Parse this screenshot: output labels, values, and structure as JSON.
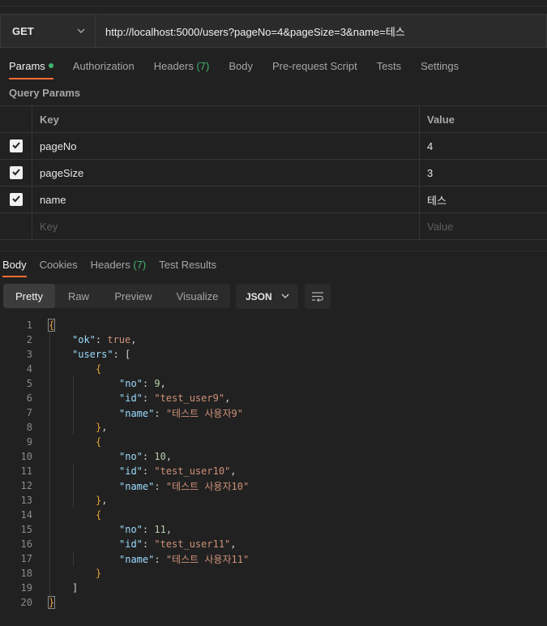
{
  "request": {
    "method": "GET",
    "url": "http://localhost:5000/users?pageNo=4&pageSize=3&name=테스"
  },
  "request_tabs": [
    {
      "label": "Params",
      "count": "",
      "dot": true,
      "active": true
    },
    {
      "label": "Authorization",
      "count": "",
      "dot": false,
      "active": false
    },
    {
      "label": "Headers",
      "count": "(7)",
      "dot": false,
      "active": false
    },
    {
      "label": "Body",
      "count": "",
      "dot": false,
      "active": false
    },
    {
      "label": "Pre-request Script",
      "count": "",
      "dot": false,
      "active": false
    },
    {
      "label": "Tests",
      "count": "",
      "dot": false,
      "active": false
    },
    {
      "label": "Settings",
      "count": "",
      "dot": false,
      "active": false
    }
  ],
  "query_params": {
    "title": "Query Params",
    "headers": {
      "key": "Key",
      "value": "Value"
    },
    "rows": [
      {
        "key": "pageNo",
        "value": "4",
        "checked": true
      },
      {
        "key": "pageSize",
        "value": "3",
        "checked": true
      },
      {
        "key": "name",
        "value": "테스",
        "checked": true
      }
    ],
    "placeholder": {
      "key": "Key",
      "value": "Value"
    }
  },
  "response_tabs": [
    {
      "label": "Body",
      "count": "",
      "active": true
    },
    {
      "label": "Cookies",
      "count": "",
      "active": false
    },
    {
      "label": "Headers",
      "count": "(7)",
      "active": false
    },
    {
      "label": "Test Results",
      "count": "",
      "active": false
    }
  ],
  "format": {
    "buttons": [
      "Pretty",
      "Raw",
      "Preview",
      "Visualize"
    ],
    "active": "Pretty",
    "language": "JSON"
  },
  "code_lines": [
    {
      "n": "1",
      "i": 0,
      "t": [
        [
          "b",
          "{"
        ]
      ]
    },
    {
      "n": "2",
      "i": 1,
      "t": [
        [
          "k",
          "\"ok\""
        ],
        [
          "p",
          ": "
        ],
        [
          "s",
          "true"
        ],
        [
          "p",
          ","
        ]
      ]
    },
    {
      "n": "3",
      "i": 1,
      "t": [
        [
          "k",
          "\"users\""
        ],
        [
          "p",
          ": ["
        ]
      ]
    },
    {
      "n": "4",
      "i": 2,
      "t": [
        [
          "b",
          "{"
        ]
      ]
    },
    {
      "n": "5",
      "i": 3,
      "t": [
        [
          "k",
          "\"no\""
        ],
        [
          "p",
          ": "
        ],
        [
          "n",
          "9"
        ],
        [
          "p",
          ","
        ]
      ]
    },
    {
      "n": "6",
      "i": 3,
      "t": [
        [
          "k",
          "\"id\""
        ],
        [
          "p",
          ": "
        ],
        [
          "s",
          "\"test_user9\""
        ],
        [
          "p",
          ","
        ]
      ]
    },
    {
      "n": "7",
      "i": 3,
      "t": [
        [
          "k",
          "\"name\""
        ],
        [
          "p",
          ": "
        ],
        [
          "s",
          "\"테스트 사용자9\""
        ]
      ]
    },
    {
      "n": "8",
      "i": 2,
      "t": [
        [
          "b",
          "}"
        ],
        [
          "p",
          ","
        ]
      ]
    },
    {
      "n": "9",
      "i": 2,
      "t": [
        [
          "b",
          "{"
        ]
      ]
    },
    {
      "n": "10",
      "i": 3,
      "t": [
        [
          "k",
          "\"no\""
        ],
        [
          "p",
          ": "
        ],
        [
          "n",
          "10"
        ],
        [
          "p",
          ","
        ]
      ]
    },
    {
      "n": "11",
      "i": 3,
      "t": [
        [
          "k",
          "\"id\""
        ],
        [
          "p",
          ": "
        ],
        [
          "s",
          "\"test_user10\""
        ],
        [
          "p",
          ","
        ]
      ]
    },
    {
      "n": "12",
      "i": 3,
      "t": [
        [
          "k",
          "\"name\""
        ],
        [
          "p",
          ": "
        ],
        [
          "s",
          "\"테스트 사용자10\""
        ]
      ]
    },
    {
      "n": "13",
      "i": 2,
      "t": [
        [
          "b",
          "}"
        ],
        [
          "p",
          ","
        ]
      ]
    },
    {
      "n": "14",
      "i": 2,
      "t": [
        [
          "b",
          "{"
        ]
      ]
    },
    {
      "n": "15",
      "i": 3,
      "t": [
        [
          "k",
          "\"no\""
        ],
        [
          "p",
          ": "
        ],
        [
          "n",
          "11"
        ],
        [
          "p",
          ","
        ]
      ]
    },
    {
      "n": "16",
      "i": 3,
      "t": [
        [
          "k",
          "\"id\""
        ],
        [
          "p",
          ": "
        ],
        [
          "s",
          "\"test_user11\""
        ],
        [
          "p",
          ","
        ]
      ]
    },
    {
      "n": "17",
      "i": 3,
      "t": [
        [
          "k",
          "\"name\""
        ],
        [
          "p",
          ": "
        ],
        [
          "s",
          "\"테스트 사용자11\""
        ]
      ]
    },
    {
      "n": "18",
      "i": 2,
      "t": [
        [
          "b",
          "}"
        ]
      ]
    },
    {
      "n": "19",
      "i": 1,
      "t": [
        [
          "p",
          "]"
        ]
      ]
    },
    {
      "n": "20",
      "i": 0,
      "t": [
        [
          "b",
          "}"
        ]
      ]
    }
  ],
  "icons": {
    "method_dropdown": "chevron-down-icon",
    "checkbox": "check-icon",
    "format_dropdown": "chevron-down-icon",
    "wrap": "wrap-lines-icon"
  },
  "colors": {
    "accent": "#ff6c37",
    "count_green": "#3fb36b"
  }
}
